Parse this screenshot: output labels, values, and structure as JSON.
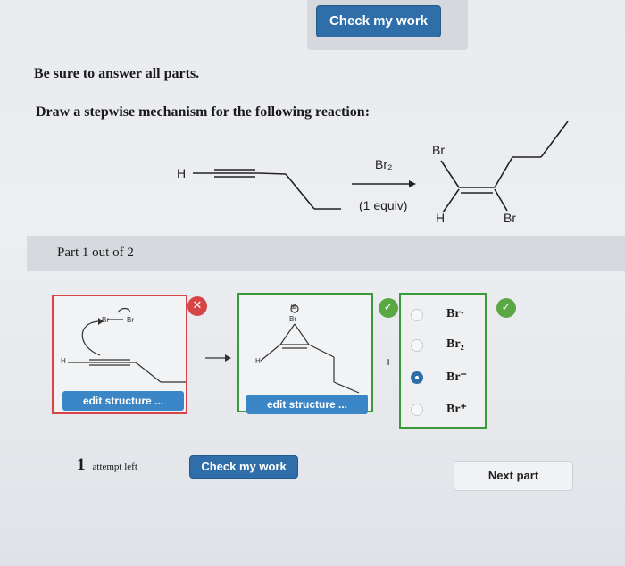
{
  "header": {
    "check_button": "Check my work"
  },
  "instructions": {
    "line1": "Be sure to answer all parts.",
    "line2": "Draw a stepwise mechanism for the following reaction:"
  },
  "reaction": {
    "reactant_h": "H",
    "reagent": "Br₂",
    "conditions": "(1 equiv)",
    "product_br_top": "Br",
    "product_h": "H",
    "product_br_bottom": "Br"
  },
  "part": {
    "label": "Part 1 out of 2"
  },
  "step1": {
    "edit_label": "edit structure ...",
    "atom_labels": [
      "Br",
      "Br",
      "H"
    ],
    "status": "incorrect"
  },
  "step2": {
    "edit_label": "edit structure ...",
    "atom_labels": [
      "⊕",
      "Br",
      "H"
    ],
    "status": "correct"
  },
  "plus_sign": "+",
  "options": {
    "items": [
      {
        "label": "Br·",
        "selected": false
      },
      {
        "label": "Br₂",
        "selected": false
      },
      {
        "label": "Br⁻",
        "selected": true
      },
      {
        "label": "Br⁺",
        "selected": false
      }
    ],
    "status": "correct"
  },
  "footer": {
    "attempts_count": "1",
    "attempts_text": "attempt left",
    "check_button": "Check my work",
    "next_button": "Next part"
  }
}
